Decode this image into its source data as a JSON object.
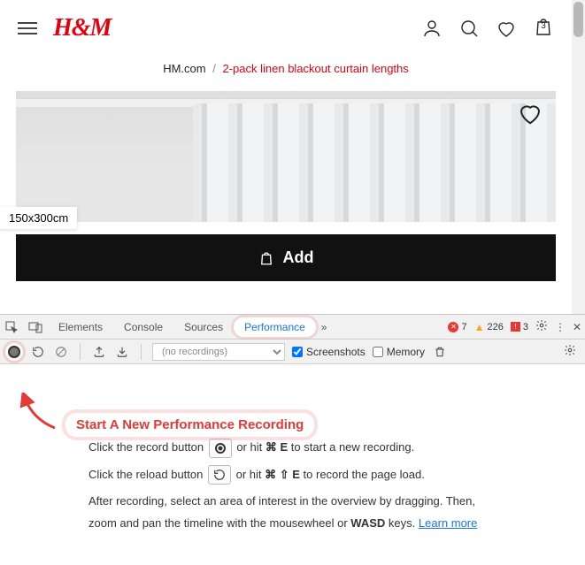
{
  "header": {
    "logo": "H&M",
    "bag_count": "3"
  },
  "breadcrumb": {
    "home": "HM.com",
    "sep": "/",
    "current": "2-pack linen blackout curtain lengths"
  },
  "product": {
    "size_label": "150x300cm",
    "add_label": "Add"
  },
  "devtools": {
    "tabs": {
      "elements": "Elements",
      "console": "Console",
      "sources": "Sources",
      "performance": "Performance"
    },
    "status": {
      "errors": "7",
      "warnings": "226",
      "issues": "3"
    },
    "perf_toolbar": {
      "recordings_placeholder": "(no recordings)",
      "screenshots": "Screenshots",
      "memory": "Memory"
    },
    "tooltip": "Start A New Performance Recording",
    "instructions": {
      "line1a": "Click the record button ",
      "line1b": " or hit ",
      "line1_keys": "⌘ E",
      "line1c": " to start a new recording.",
      "line2a": "Click the reload button ",
      "line2b": " or hit ",
      "line2_keys": "⌘ ⇧ E",
      "line2c": " to record the page load.",
      "line3a": "After recording, select an area of interest in the overview by dragging. Then, zoom and pan the timeline with the mousewheel or ",
      "line3_keys": "WASD",
      "line3b": " keys. ",
      "learn_more": "Learn more"
    }
  }
}
